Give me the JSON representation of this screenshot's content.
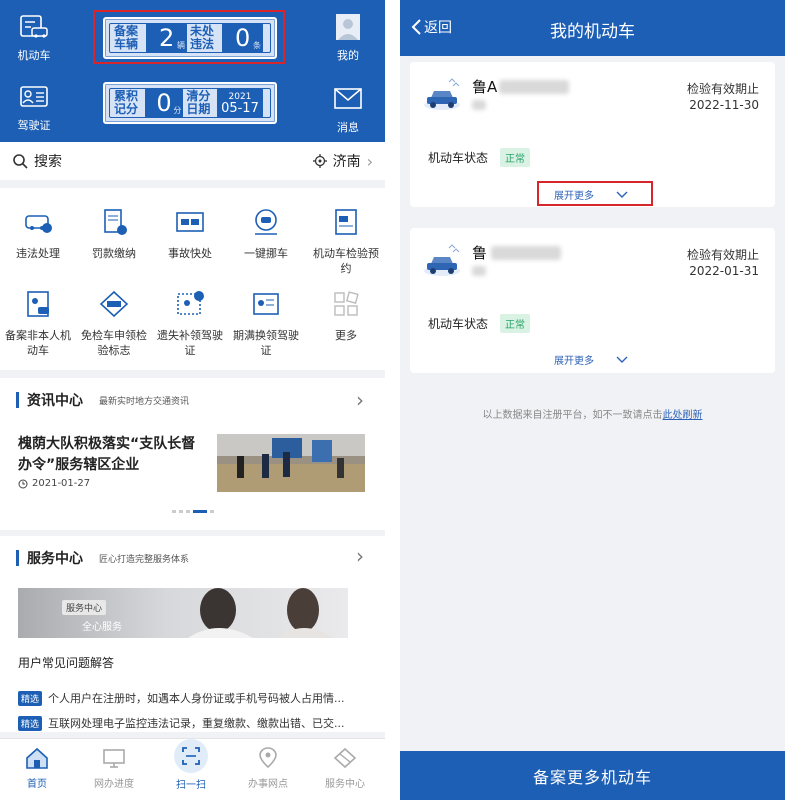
{
  "left": {
    "header": {
      "vehicle_btn": "机动车",
      "license_btn": "驾驶证",
      "mine_btn": "我的",
      "message_btn": "消息",
      "box1": {
        "label_a": "备案车辆",
        "value_a": "2",
        "unit_a": "辆",
        "label_b": "未处违法",
        "value_b": "0",
        "unit_b": "条"
      },
      "box2": {
        "label_a": "累积记分",
        "value_a": "0",
        "unit_a": "分",
        "label_b": "清分日期",
        "year": "2021",
        "date": "05-17"
      }
    },
    "search": {
      "placeholder": "搜索",
      "city": "济南"
    },
    "services": [
      {
        "label": "违法处理"
      },
      {
        "label": "罚款缴纳"
      },
      {
        "label": "事故快处"
      },
      {
        "label": "一键挪车"
      },
      {
        "label": "机动车检验预约"
      },
      {
        "label": "备案非本人机动车"
      },
      {
        "label": "免检车申领检验标志"
      },
      {
        "label": "遗失补领驾驶证"
      },
      {
        "label": "期满换领驾驶证"
      },
      {
        "label": "更多"
      }
    ],
    "news": {
      "title": "资讯中心",
      "subtitle": "最新实时地方交通资讯",
      "headline": "槐荫大队积极落实“支队长督办令”服务辖区企业",
      "date": "2021-01-27"
    },
    "service_center": {
      "title": "服务中心",
      "subtitle": "匠心打造完整服务体系",
      "banner_tag": "服务中心",
      "banner_text": "全心服务",
      "faq_title": "用户常见问题解答",
      "items": [
        {
          "tag": "精选",
          "text": "个人用户在注册时，如遇本人身份证或手机号码被人占用情..."
        },
        {
          "tag": "精选",
          "text": "互联网处理电子监控违法记录，重复缴款、缴款出错、已交..."
        }
      ]
    },
    "tabbar": [
      {
        "label": "首页"
      },
      {
        "label": "网办进度"
      },
      {
        "label": "扫一扫"
      },
      {
        "label": "办事网点"
      },
      {
        "label": "服务中心"
      }
    ]
  },
  "right": {
    "back": "返回",
    "title": "我的机动车",
    "cards": [
      {
        "plate": "鲁A",
        "inspection_label": "检验有效期止",
        "inspection_date": "2022-11-30",
        "status_label": "机动车状态",
        "status": "正常",
        "expand": "展开更多"
      },
      {
        "plate": "鲁",
        "inspection_label": "检验有效期止",
        "inspection_date": "2022-01-31",
        "status_label": "机动车状态",
        "status": "正常",
        "expand": "展开更多"
      }
    ],
    "notice": "以上数据来自注册平台，如不一致请点击",
    "refresh_link": "此处刷新",
    "bottom_button": "备案更多机动车"
  },
  "colors": {
    "brand": "#1d5fb5",
    "highlight": "#d6262b",
    "status_green": "#29a36a"
  }
}
